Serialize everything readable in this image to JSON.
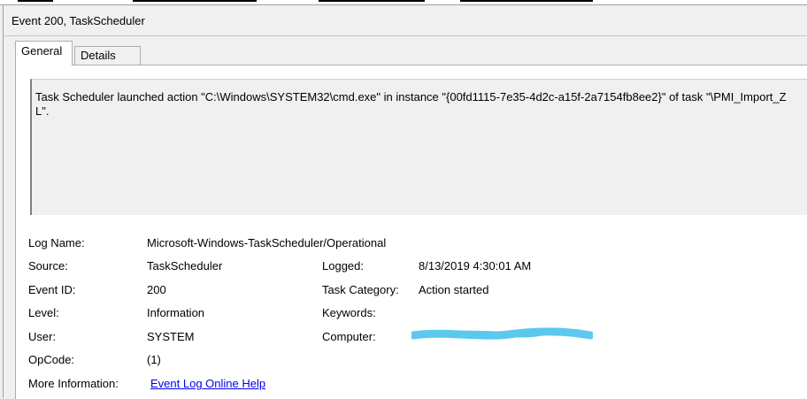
{
  "window": {
    "title": "Event 200, TaskScheduler"
  },
  "tabs": [
    {
      "label": "General",
      "active": true
    },
    {
      "label": "Details",
      "active": false
    }
  ],
  "general": {
    "description": "Task Scheduler launched action \"C:\\Windows\\SYSTEM32\\cmd.exe\" in instance \"{00fd1115-7e35-4d2c-a15f-2a7154fb8ee2}\" of task \"\\PMI_Import_ZL\".",
    "fields": {
      "log_name": {
        "label": "Log Name:",
        "value": "Microsoft-Windows-TaskScheduler/Operational"
      },
      "source": {
        "label": "Source:",
        "value": "TaskScheduler"
      },
      "logged": {
        "label": "Logged:",
        "value": "8/13/2019 4:30:01 AM"
      },
      "event_id": {
        "label": "Event ID:",
        "value": "200"
      },
      "task_category": {
        "label": "Task Category:",
        "value": "Action started"
      },
      "level": {
        "label": "Level:",
        "value": "Information"
      },
      "keywords": {
        "label": "Keywords:",
        "value": ""
      },
      "user": {
        "label": "User:",
        "value": "SYSTEM"
      },
      "computer": {
        "label": "Computer:",
        "value": ""
      },
      "opcode": {
        "label": "OpCode:",
        "value": "(1)"
      },
      "more_info": {
        "label": "More Information:",
        "value": "Event Log Online Help"
      }
    }
  },
  "colors": {
    "link": "#0000ee",
    "redaction": "#5bc8ee",
    "window_bg": "#f0f0f0",
    "panel_bg": "#ffffff"
  }
}
